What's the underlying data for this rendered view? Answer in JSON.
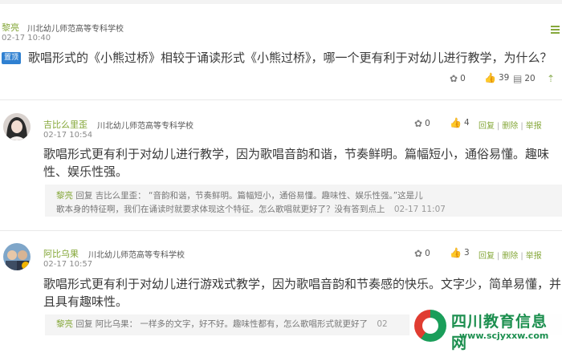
{
  "post": {
    "author": "黎亮",
    "school": "川北幼儿师范高等专科学校",
    "time": "02-17 10:40",
    "pin_label": "置顶",
    "title": "歌唱形式的《小熊过桥》相较于诵读形式《小熊过桥》，哪一个更有利于对幼儿进行教学，为什么？",
    "flower_count": "0",
    "like_count": "39",
    "comment_count": "20"
  },
  "replies": [
    {
      "author": "吉比么里歪",
      "school": "川北幼儿师范高等专科学校",
      "time": "02-17 10:54",
      "flower_count": "0",
      "like_count": "4",
      "text_line1": "歌唱形式更有利于对幼儿进行教学，因为歌唱音韵和谐，节奏鲜明。篇幅短小，通俗易懂。趣味",
      "text_line2": "性、娱乐性强。",
      "quote_author": "黎亮",
      "quote_reply_word": "回复",
      "quote_target": "吉比么里歪：",
      "quote_line1": "“音韵和谐，节奏鲜明。篇幅短小，通俗易懂。趣味性、娱乐性强。”这是儿",
      "quote_line2": "歌本身的特征啊，我们在诵读时就要求体现这个特征。怎么歌唱就更好了？没有答到点上",
      "quote_time": "02-17 11:07"
    },
    {
      "author": "阿比乌果",
      "school": "川北幼儿师范高等专科学校",
      "time": "02-17 10:57",
      "flower_count": "0",
      "like_count": "3",
      "text_line1": "歌唱形式更有利于对幼儿进行游戏式教学，因为歌唱音韵和节奏感的快乐。文字少，简单易懂，并",
      "text_line2": "且具有趣味性。",
      "quote_author": "黎亮",
      "quote_reply_word": "回复",
      "quote_target": "阿比乌果：",
      "quote_line1": "一样多的文字，好不好。趣味性都有，怎么歌唱形式就更好了",
      "quote_time": "02"
    }
  ],
  "actions": {
    "reply": "回复",
    "delete": "删除",
    "report": "举报",
    "sep": "|"
  },
  "watermark": {
    "title": "四川教育信息网",
    "url": "www.scjyxxw.com"
  },
  "colors": {
    "accent_green": "#86a83b",
    "pin_blue": "#2f80d1"
  }
}
